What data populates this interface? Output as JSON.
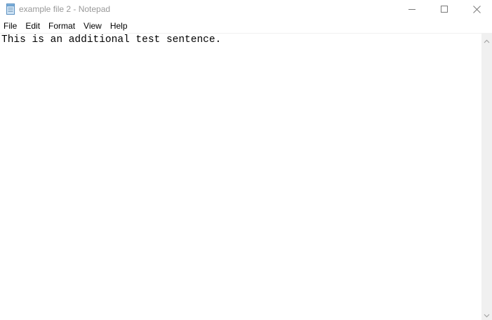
{
  "window": {
    "title": "example file 2 - Notepad"
  },
  "menu": {
    "items": [
      {
        "label": "File"
      },
      {
        "label": "Edit"
      },
      {
        "label": "Format"
      },
      {
        "label": "View"
      },
      {
        "label": "Help"
      }
    ]
  },
  "editor": {
    "content": "This is an additional test sentence."
  },
  "icons": {
    "app": "notepad-icon",
    "minimize": "minimize-icon",
    "maximize": "maximize-icon",
    "close": "close-icon",
    "scroll_up": "scroll-up-arrow-icon",
    "scroll_down": "scroll-down-arrow-icon"
  }
}
